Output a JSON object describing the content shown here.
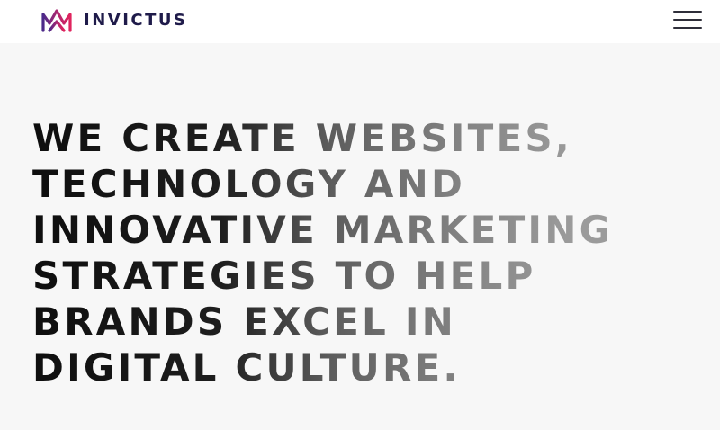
{
  "header": {
    "brand_name": "INVICTUS",
    "logo_icon": "crown-logo-icon",
    "menu_icon": "hamburger-menu-icon"
  },
  "hero": {
    "headline_lines": [
      "WE CREATE WEBSITES,",
      "TECHNOLOGY AND",
      "INNOVATIVE MARKETING",
      "STRATEGIES TO HELP",
      "BRANDS EXCEL IN",
      "DIGITAL CULTURE."
    ]
  },
  "colors": {
    "brand_purple": "#5b2c83",
    "brand_pink": "#e0245e",
    "brand_navy": "#1f1b4a",
    "hero_background": "#f7f7f7"
  }
}
